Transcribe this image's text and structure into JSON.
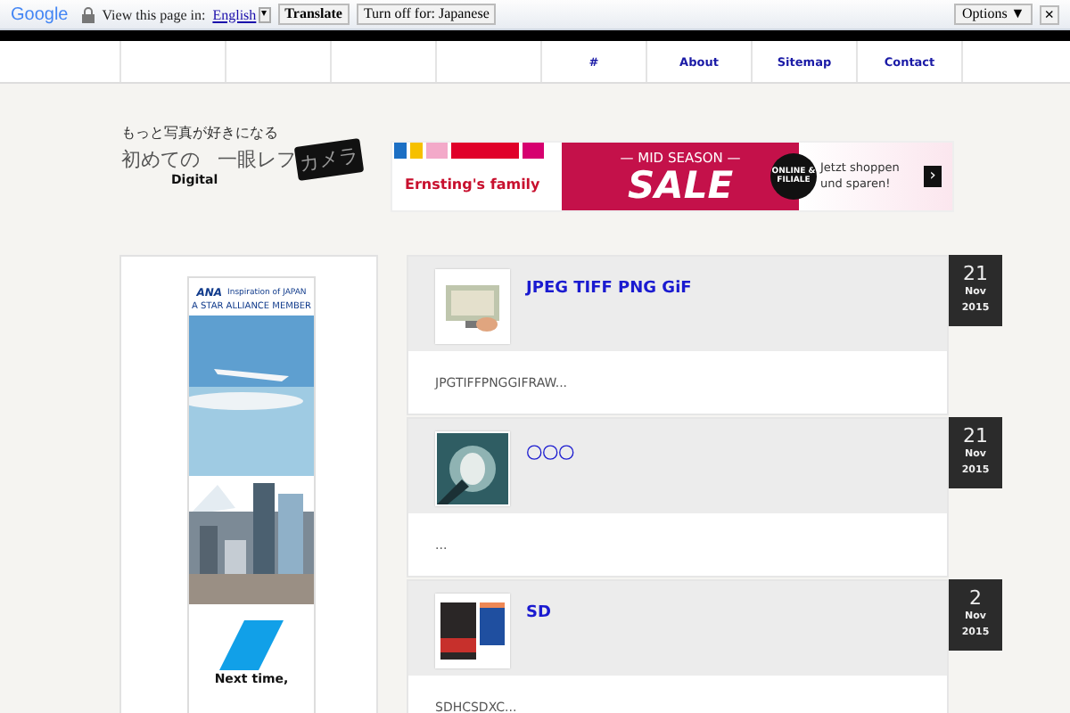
{
  "translate_bar": {
    "logo": "Google",
    "prompt": "View this page in:",
    "language": "English",
    "caret": "▾",
    "translate_button": "Translate",
    "turn_off_button": "Turn off for: Japanese",
    "options_button": "Options ▼",
    "close": "×"
  },
  "nav": [
    {
      "kind": "blank"
    },
    {
      "kind": "blank"
    },
    {
      "kind": "blank"
    },
    {
      "kind": "blank"
    },
    {
      "kind": "link",
      "label": "#"
    },
    {
      "kind": "link",
      "label": "About"
    },
    {
      "kind": "link",
      "label": "Sitemap"
    },
    {
      "kind": "link",
      "label": "Contact"
    }
  ],
  "logo": {
    "tagline": "もっと写真が好きになる",
    "first": "初めての",
    "digital": "Digital",
    "main": "一眼レフ",
    "camera": "カメラ"
  },
  "banner_ad": {
    "brand": "Ernsting's family",
    "headline": "— MID SEASON —",
    "sale": "SALE",
    "badge": "ONLINE & FILIALE",
    "cta": "Jetzt shoppen und sparen!",
    "arrow": "›"
  },
  "sidebar_ad": {
    "brand": "ANA",
    "tagline": "Inspiration of JAPAN",
    "member": "A STAR ALLIANCE MEMBER",
    "slogan": "Next time,"
  },
  "posts": [
    {
      "title": "JPEG TIFF PNG GiF",
      "excerpt": "JPGTIFFPNGGIFRAW...",
      "day": "21",
      "month": "Nov",
      "year": "2015"
    },
    {
      "title": "〇〇〇",
      "excerpt": "...",
      "day": "21",
      "month": "Nov",
      "year": "2015"
    },
    {
      "title": "SD",
      "excerpt": "SDHCSDXC...",
      "day": "2",
      "month": "Nov",
      "year": "2015"
    }
  ]
}
